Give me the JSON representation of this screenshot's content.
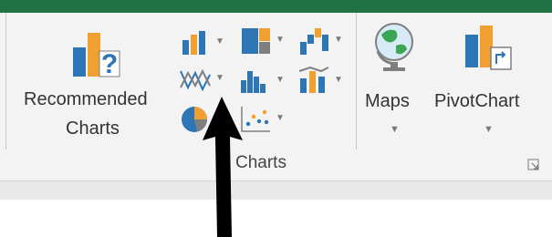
{
  "ribbon": {
    "group_label": "Charts",
    "recommended": {
      "line1": "Recommended",
      "line2": "Charts"
    },
    "maps": {
      "label": "Maps"
    },
    "pivotchart": {
      "label": "PivotChart"
    },
    "small_buttons": [
      {
        "name": "column-bar-chart",
        "icon": "column-chart-icon"
      },
      {
        "name": "hierarchy-chart",
        "icon": "treemap-icon"
      },
      {
        "name": "waterfall-chart",
        "icon": "waterfall-icon"
      },
      {
        "name": "line-area-chart",
        "icon": "line-chart-icon"
      },
      {
        "name": "statistic-chart",
        "icon": "histogram-icon"
      },
      {
        "name": "combo-chart",
        "icon": "combo-chart-icon"
      },
      {
        "name": "pie-doughnut-chart",
        "icon": "pie-chart-icon"
      },
      {
        "name": "scatter-bubble-chart",
        "icon": "scatter-chart-icon"
      }
    ],
    "colors": {
      "excel_green": "#217346",
      "chart_blue": "#2e75b6",
      "chart_orange": "#f0a030",
      "chart_gray": "#7f7f7f"
    }
  }
}
